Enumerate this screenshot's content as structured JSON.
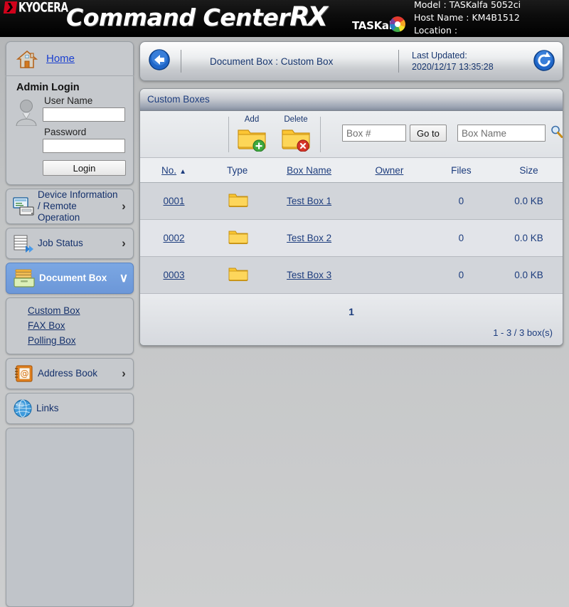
{
  "header": {
    "brand": "KYOCERA",
    "product_title": "Command Center",
    "product_title_rx": "RX",
    "series": "TASKalfa",
    "model_label": "Model : TASKalfa 5052ci",
    "hostname_label": "Host Name : KM4B1512",
    "location_label": "Location :"
  },
  "sidebar": {
    "home_label": "Home",
    "login": {
      "title": "Admin Login",
      "username_label": "User Name",
      "username_value": "",
      "username_placeholder": "",
      "password_label": "Password",
      "password_value": "",
      "password_placeholder": "",
      "login_button": "Login"
    },
    "items": [
      {
        "label": "Device Information / Remote Operation",
        "icon": "device-icon",
        "chevron": "›",
        "active": false
      },
      {
        "label": "Job Status",
        "icon": "job-status-icon",
        "chevron": "›",
        "active": false
      },
      {
        "label": "Document Box",
        "icon": "document-box-icon",
        "chevron": "∨",
        "active": true
      },
      {
        "label": "Address Book",
        "icon": "address-book-icon",
        "chevron": "›",
        "active": false
      },
      {
        "label": "Links",
        "icon": "links-icon",
        "chevron": "",
        "active": false
      }
    ],
    "sub_items": [
      {
        "label": "Custom Box"
      },
      {
        "label": "FAX Box"
      },
      {
        "label": "Polling Box"
      }
    ]
  },
  "content_header": {
    "back_icon": "back-arrow-icon",
    "breadcrumb": "Document Box : Custom Box",
    "last_updated_label": "Last Updated:",
    "last_updated_value": "2020/12/17 13:35:28",
    "refresh_icon": "refresh-icon"
  },
  "main": {
    "panel_title": "Custom Boxes",
    "toolbar": {
      "add_label": "Add",
      "delete_label": "Delete",
      "box_number_value": "",
      "box_number_placeholder": "Box #",
      "goto_label": "Go to",
      "box_name_value": "",
      "box_name_placeholder": "Box Name",
      "search_icon": "search-magnifier-icon"
    },
    "table": {
      "columns": [
        {
          "label": "No.",
          "sortable": true,
          "sorted": "asc"
        },
        {
          "label": "Type",
          "sortable": false
        },
        {
          "label": "Box Name",
          "sortable": true
        },
        {
          "label": "Owner",
          "sortable": true
        },
        {
          "label": "Files",
          "sortable": false
        },
        {
          "label": "Size",
          "sortable": false
        }
      ],
      "rows": [
        {
          "no": "0001",
          "type_icon": "folder-icon",
          "box_name": "Test Box 1",
          "owner": "",
          "files": "0",
          "size": "0.0 KB"
        },
        {
          "no": "0002",
          "type_icon": "folder-icon",
          "box_name": "Test Box 2",
          "owner": "",
          "files": "0",
          "size": "0.0 KB"
        },
        {
          "no": "0003",
          "type_icon": "folder-icon",
          "box_name": "Test Box 3",
          "owner": "",
          "files": "0",
          "size": "0.0 KB"
        }
      ]
    },
    "pager": {
      "current_page": "1",
      "count_text": "1 - 3 / 3 box(s)"
    }
  },
  "colors": {
    "accent_blue": "#1c3c7d",
    "active_menu": "#6c97d8",
    "link_blue": "#1a3fd0",
    "brand_red": "#d0021b"
  }
}
